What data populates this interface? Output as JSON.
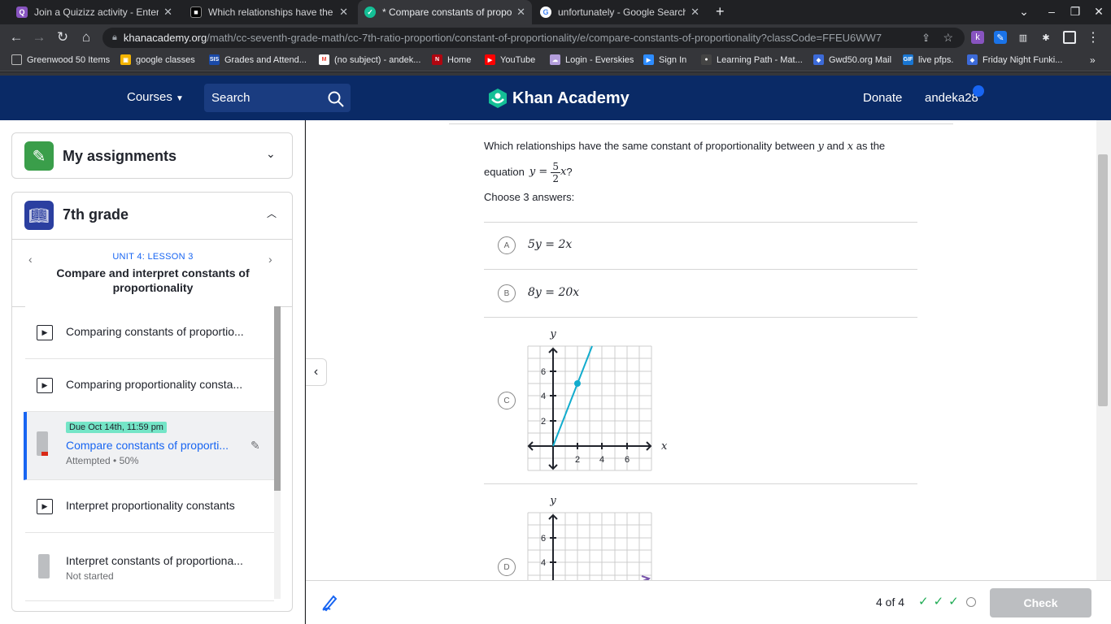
{
  "tabs": [
    {
      "title": "Join a Quizizz activity - Enter co",
      "icon": "quizizz-icon"
    },
    {
      "title": "Which relationships have the sa",
      "icon": "page-icon"
    },
    {
      "title": "* Compare constants of proporti",
      "icon": "khan-academy-icon"
    },
    {
      "title": "unfortunately - Google Search",
      "icon": "google-icon"
    }
  ],
  "url": {
    "domain": "khanacademy.org",
    "path": "/math/cc-seventh-grade-math/cc-7th-ratio-proportion/constant-of-proportionality/e/compare-constants-of-proportionality?classCode=FFEU6WW7"
  },
  "bookmarks": [
    "Greenwood 50 Items",
    "google classes",
    "Grades and Attend...",
    "(no subject) - andek...",
    "Home",
    "YouTube",
    "Login - Everskies",
    "Sign In",
    "Learning Path - Mat...",
    "Gwd50.org Mail",
    "live pfps.",
    "Friday Night Funki..."
  ],
  "header": {
    "courses": "Courses",
    "search": "Search",
    "logo": "Khan Academy",
    "donate": "Donate",
    "user": "andeka28"
  },
  "sidebar": {
    "assignments": "My assignments",
    "grade": "7th grade",
    "unit": "UNIT 4: LESSON 3",
    "lesson_title": "Compare and interpret constants of proportionality",
    "items": [
      {
        "title": "Comparing constants of proportio...",
        "type": "video"
      },
      {
        "title": "Comparing proportionality consta...",
        "type": "video"
      },
      {
        "title": "Compare constants of proporti...",
        "type": "exercise",
        "due": "Due Oct 14th, 11:59 pm",
        "status": "Attempted • 50%"
      },
      {
        "title": "Interpret proportionality constants",
        "type": "video"
      },
      {
        "title": "Interpret constants of proportiona...",
        "type": "exercise",
        "status": "Not started"
      }
    ]
  },
  "question": {
    "text_pre": "Which relationships have the same constant of proportionality between",
    "var_y": "y",
    "and": "and",
    "var_x": "x",
    "text_post": "as the",
    "equation_label": "equation",
    "choose": "Choose 3 answers:",
    "choices": [
      {
        "letter": "A",
        "eq": "5y = 2x"
      },
      {
        "letter": "B",
        "eq": "8y = 20x"
      },
      {
        "letter": "C"
      },
      {
        "letter": "D"
      }
    ]
  },
  "graph": {
    "ylabel": "y",
    "xlabel": "x",
    "xticks": [
      "2",
      "4",
      "6"
    ],
    "yticks": [
      "2",
      "4",
      "6"
    ],
    "point": [
      2,
      5
    ]
  },
  "footer": {
    "progress": "4 of 4",
    "check": "Check"
  }
}
